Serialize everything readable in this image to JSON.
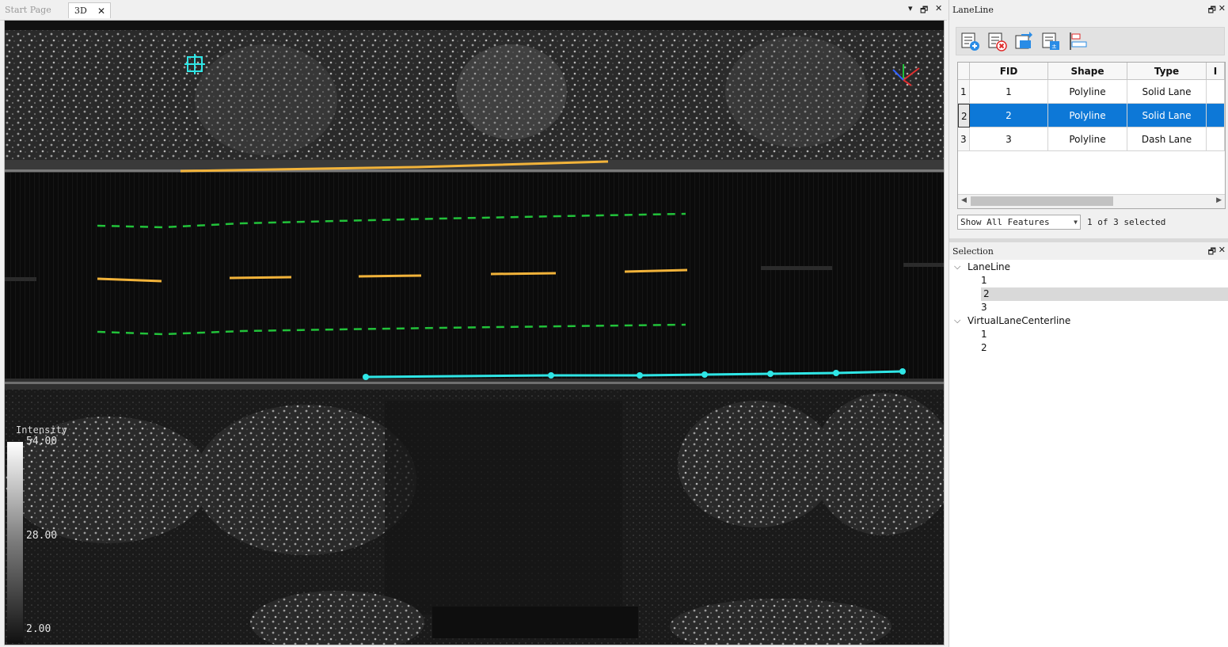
{
  "doc_tabs": {
    "start_page": "Start Page",
    "view3d": "3D"
  },
  "legend": {
    "title": "Intensity",
    "max": "54.00",
    "mid": "28.00",
    "min": "2.00"
  },
  "laneline_panel": {
    "title": "LaneLine",
    "toolbar": [
      "add-feature-icon",
      "delete-feature-icon",
      "export-icon",
      "field-calc-icon",
      "align-icon"
    ],
    "columns": [
      "FID",
      "Shape",
      "Type",
      "I"
    ],
    "rows": [
      {
        "num": "1",
        "fid": "1",
        "shape": "Polyline",
        "type": "Solid Lane"
      },
      {
        "num": "2",
        "fid": "2",
        "shape": "Polyline",
        "type": "Solid Lane"
      },
      {
        "num": "3",
        "fid": "3",
        "shape": "Polyline",
        "type": "Dash Lane"
      }
    ],
    "selected_row": 2,
    "filter": "Show All Features",
    "selection_status": "1 of 3 selected"
  },
  "selection_panel": {
    "title": "Selection",
    "groups": [
      {
        "name": "LaneLine",
        "items": [
          "1",
          "2",
          "3"
        ]
      },
      {
        "name": "VirtualLaneCenterline",
        "items": [
          "1",
          "2"
        ]
      }
    ],
    "highlighted_item": "2"
  },
  "colors": {
    "solid_lane": "#f2b33a",
    "virtual_centerline": "#22c23a",
    "selected_line": "#2fe6e6",
    "selection_blue": "#0d78d7"
  }
}
